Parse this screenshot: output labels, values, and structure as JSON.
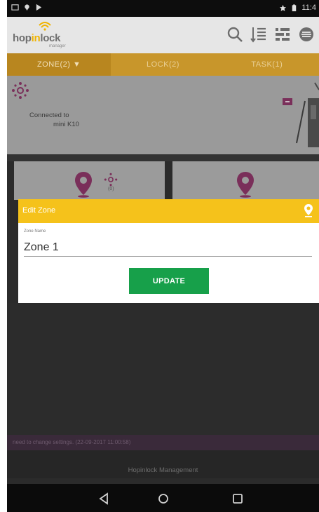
{
  "status_bar": {
    "time": "11:4"
  },
  "app_bar": {
    "logo_text_a": "hop",
    "logo_text_b": "in",
    "logo_text_c": "lock",
    "logo_sub": "manager"
  },
  "tabs": [
    {
      "label": "ZONE(2)",
      "active": true
    },
    {
      "label": "LOCK(2)",
      "active": false
    },
    {
      "label": "TASK(1)",
      "active": false
    }
  ],
  "connection": {
    "line1": "Connected to",
    "line2": "mini K10"
  },
  "zone_card": {
    "count": "(0)"
  },
  "dialog": {
    "title": "Edit Zone",
    "field_label": "Zone Name",
    "field_value": "Zone 1",
    "button": "UPDATE"
  },
  "notice": "need to change settings. (22-09-2017 11:00:58)",
  "footer": "Hopinlock Management",
  "colors": {
    "accent": "#f5c21b",
    "tab_bar": "#c8962b",
    "update_button": "#17a04a",
    "pin": "#7a2f5a"
  }
}
